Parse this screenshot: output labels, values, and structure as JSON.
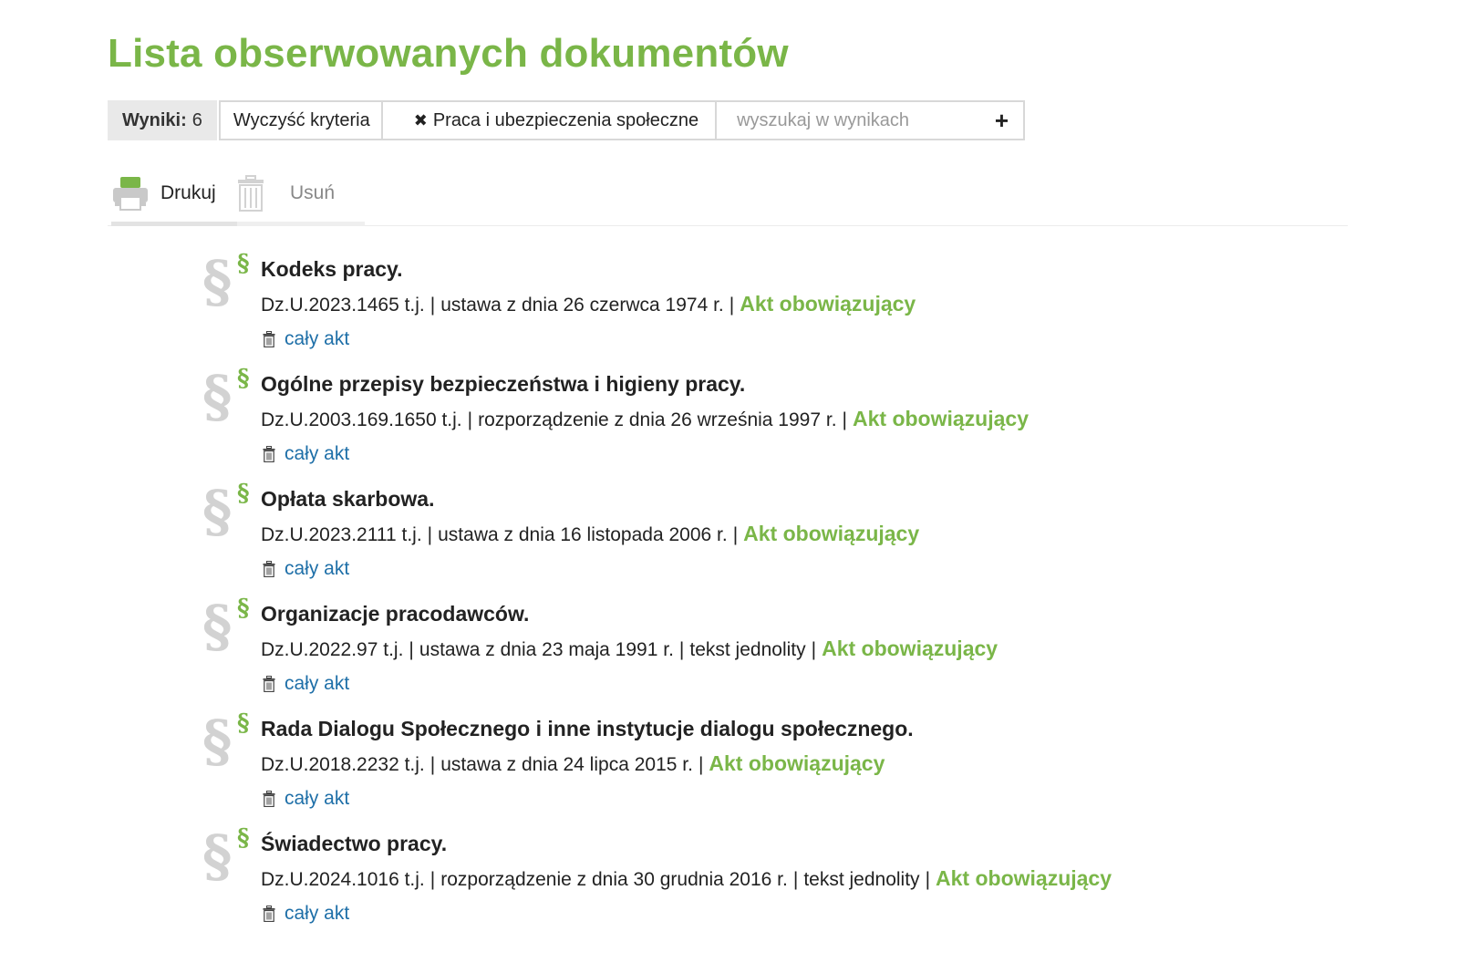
{
  "page": {
    "title": "Lista obserwowanych dokumentów"
  },
  "filter_bar": {
    "results_label": "Wyniki:",
    "results_count": "6",
    "clear_label": "Wyczyść kryteria",
    "criteria_remove_glyph": "✖",
    "criteria_tag": "Praca i ubezpieczenia społeczne",
    "search_placeholder": "wyszukaj w wynikach",
    "add_glyph": "+"
  },
  "toolbar": {
    "print_label": "Drukuj",
    "delete_label": "Usuń"
  },
  "colors": {
    "accent_green": "#7ab648",
    "link_blue": "#1e6fa8",
    "icon_gray": "#d2d2d2"
  },
  "documents": [
    {
      "icon": "paragraph-icon",
      "title": "Kodeks pracy.",
      "meta": [
        "Dz.U.2023.1465 t.j.",
        "ustawa z dnia 26 czerwca 1974 r."
      ],
      "status": "Akt obowiązujący",
      "link": "cały akt"
    },
    {
      "icon": "paragraph-icon",
      "title": "Ogólne przepisy bezpieczeństwa i higieny pracy.",
      "meta": [
        "Dz.U.2003.169.1650 t.j.",
        "rozporządzenie z dnia 26 września 1997 r."
      ],
      "status": "Akt obowiązujący",
      "link": "cały akt"
    },
    {
      "icon": "paragraph-icon",
      "title": "Opłata skarbowa.",
      "meta": [
        "Dz.U.2023.2111 t.j.",
        "ustawa z dnia 16 listopada 2006 r."
      ],
      "status": "Akt obowiązujący",
      "link": "cały akt"
    },
    {
      "icon": "paragraph-icon",
      "title": "Organizacje pracodawców.",
      "meta": [
        "Dz.U.2022.97 t.j.",
        "ustawa z dnia 23 maja 1991 r.",
        "tekst jednolity"
      ],
      "status": "Akt obowiązujący",
      "link": "cały akt"
    },
    {
      "icon": "paragraph-icon",
      "title": "Rada Dialogu Społecznego i inne instytucje dialogu społecznego.",
      "meta": [
        "Dz.U.2018.2232 t.j.",
        "ustawa z dnia 24 lipca 2015 r."
      ],
      "status": "Akt obowiązujący",
      "link": "cały akt"
    },
    {
      "icon": "paragraph-icon",
      "title": "Świadectwo pracy.",
      "meta": [
        "Dz.U.2024.1016 t.j.",
        "rozporządzenie z dnia 30 grudnia 2016 r.",
        "tekst jednolity"
      ],
      "status": "Akt obowiązujący",
      "link": "cały akt"
    }
  ]
}
